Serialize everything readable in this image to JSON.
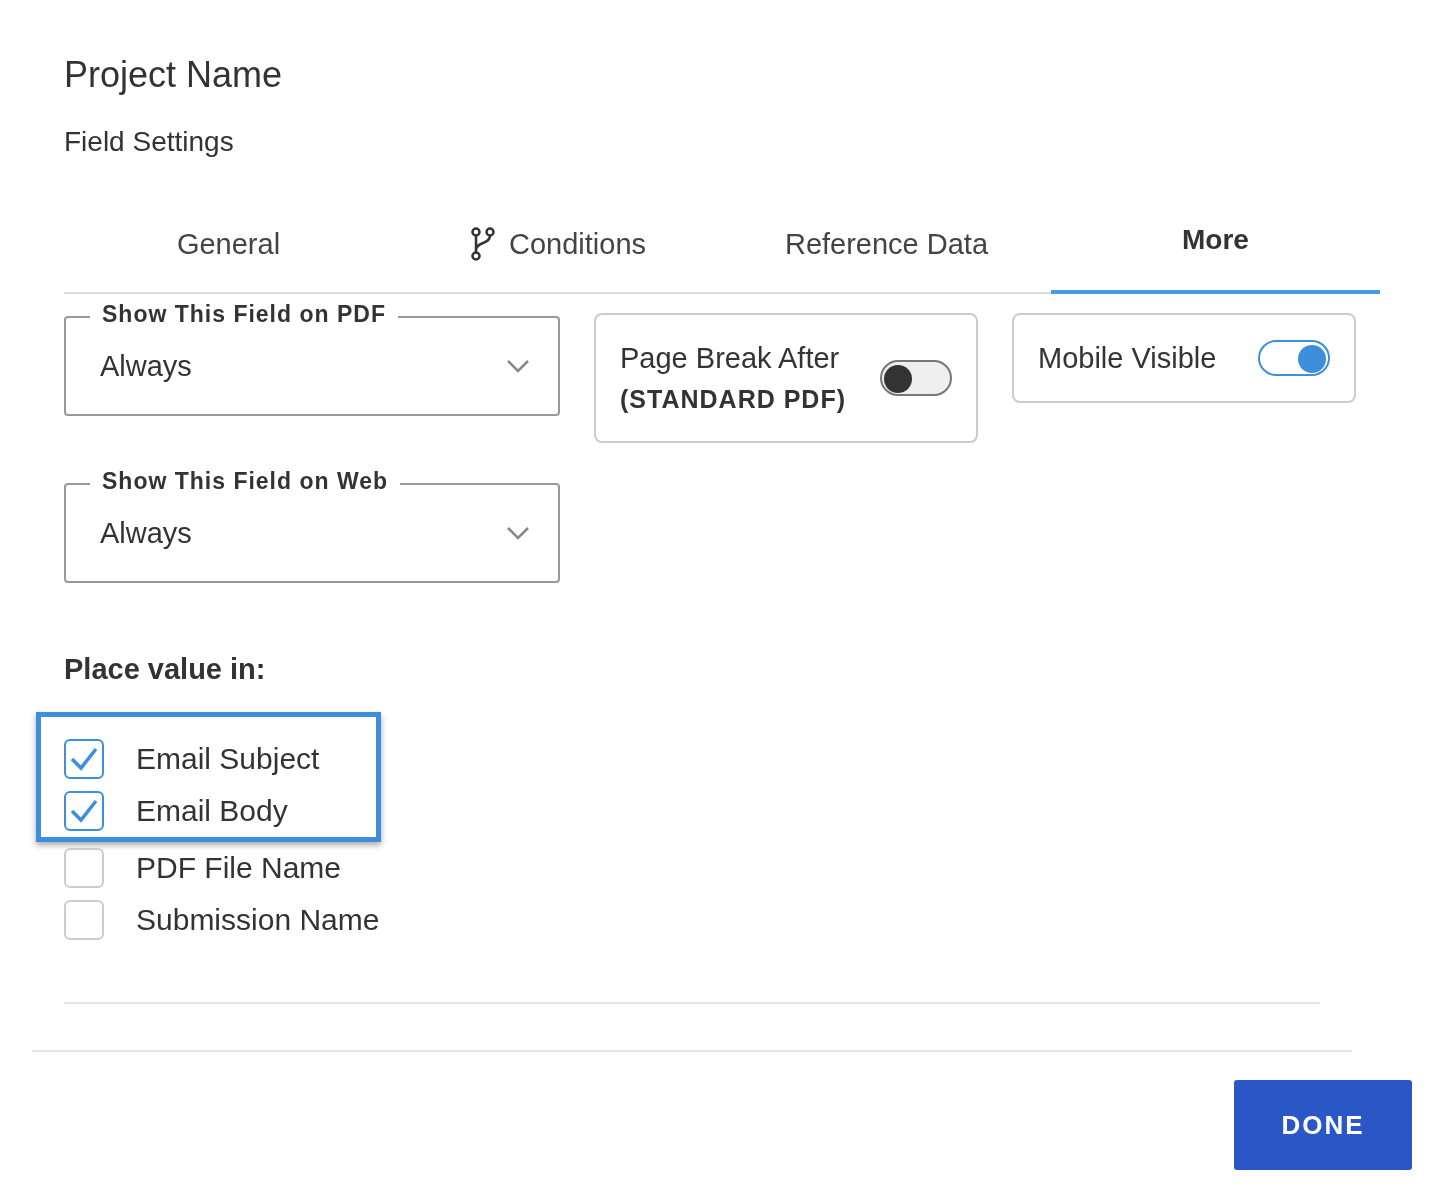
{
  "dialog": {
    "title": "Project Name",
    "subtitle": "Field Settings"
  },
  "tabs": [
    {
      "label": "General",
      "kind": "plain",
      "selected": false
    },
    {
      "label": "Conditions",
      "kind": "branch",
      "selected": false
    },
    {
      "label": "Reference Data",
      "kind": "plain",
      "selected": false
    },
    {
      "label": "More",
      "kind": "plain",
      "selected": true
    }
  ],
  "selects": [
    {
      "legend": "Show This Field on PDF",
      "value": "Always"
    },
    {
      "legend": "Show This Field on Web",
      "value": "Always"
    }
  ],
  "toggles": [
    {
      "label": "Page Break After",
      "note": "(STANDARD PDF)",
      "on": false
    },
    {
      "label": "Mobile Visible",
      "on": true
    }
  ],
  "place_value": {
    "heading": "Place value in:",
    "options": [
      {
        "label": "Email Subject",
        "checked": true,
        "highlighted": true
      },
      {
        "label": "Email Body",
        "checked": true,
        "highlighted": true
      },
      {
        "label": "PDF File Name",
        "checked": false,
        "highlighted": false
      },
      {
        "label": "Submission Name",
        "checked": false,
        "highlighted": false
      }
    ]
  },
  "footer": {
    "button": "DONE"
  }
}
